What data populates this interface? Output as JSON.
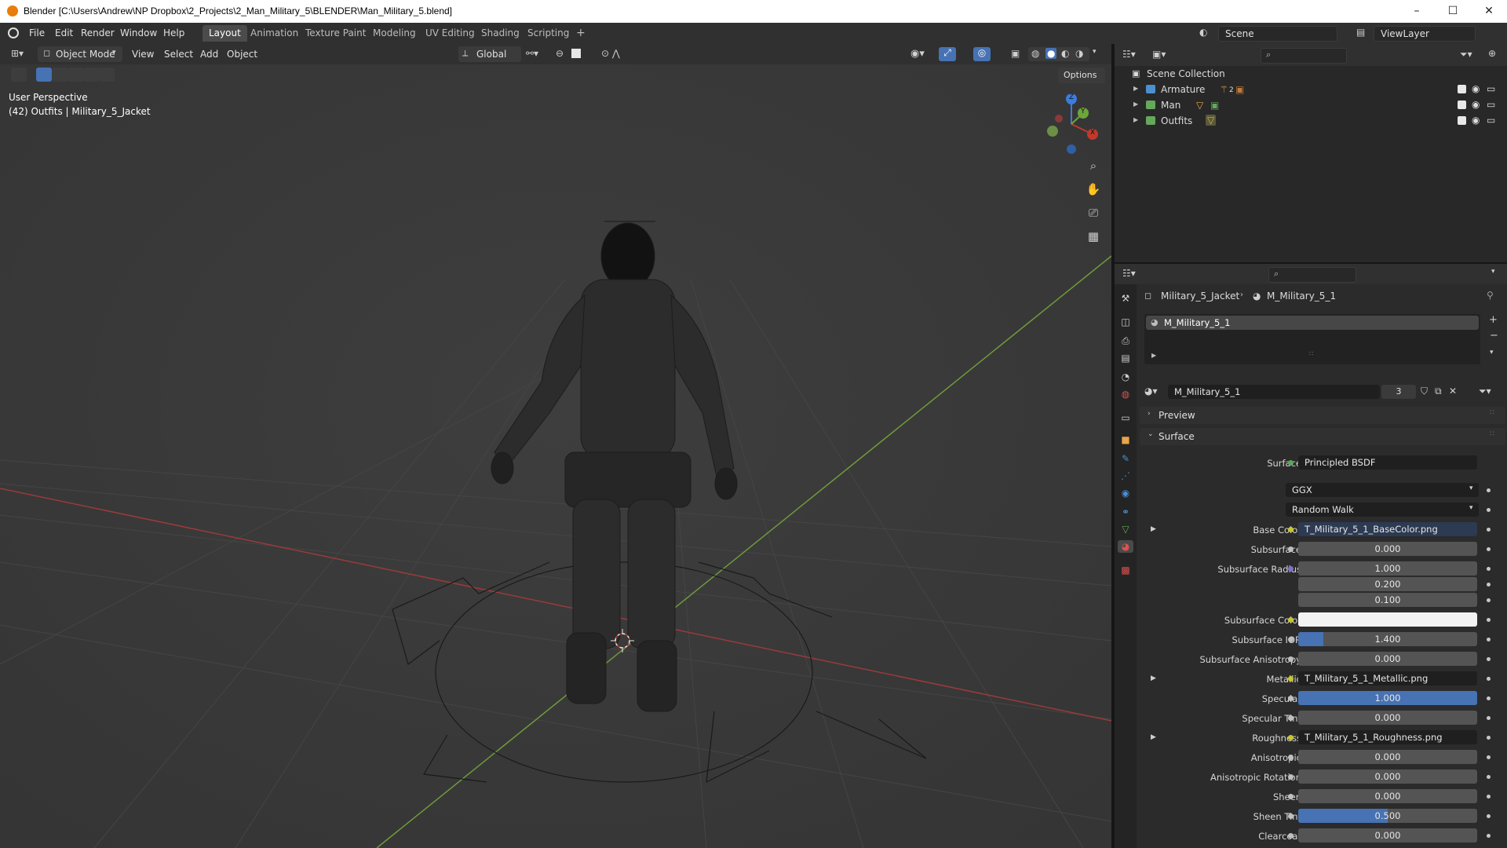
{
  "window": {
    "title": "Blender [C:\\Users\\Andrew\\NP Dropbox\\2_Projects\\2_Man_Military_5\\BLENDER\\Man_Military_5.blend]",
    "minimize": "–",
    "maximize": "☐",
    "close": "✕"
  },
  "menubar": {
    "items": [
      "File",
      "Edit",
      "Render",
      "Window",
      "Help"
    ],
    "workspaces": [
      "Layout",
      "Animation",
      "Texture Paint",
      "Modeling",
      "UV Editing",
      "Shading",
      "Scripting"
    ],
    "active_workspace": "Layout",
    "add_workspace": "+",
    "scene_label": "Scene",
    "viewlayer_label": "ViewLayer"
  },
  "viewport": {
    "mode": "Object Mode",
    "menus": [
      "View",
      "Select",
      "Add",
      "Object"
    ],
    "transform_orientation": "Global",
    "options_label": "Options",
    "perspective_label": "User Perspective",
    "context_label": "(42) Outfits | Military_5_Jacket",
    "gizmo_axes": [
      "X",
      "Y",
      "Z"
    ]
  },
  "outliner": {
    "root": "Scene Collection",
    "items": [
      {
        "label": "Armature",
        "badge": "2"
      },
      {
        "label": "Man",
        "badge": ""
      },
      {
        "label": "Outfits",
        "badge": ""
      }
    ]
  },
  "properties": {
    "breadcrumb_object": "Military_5_Jacket",
    "breadcrumb_material": "M_Military_5_1",
    "slot_name": "M_Military_5_1",
    "material_name": "M_Military_5_1",
    "user_count": "3",
    "panels": {
      "preview": "Preview",
      "surface": "Surface"
    },
    "surface_shader_label": "Surface",
    "surface_shader": "Principled BSDF",
    "distribution": "GGX",
    "subsurface_method": "Random Walk",
    "fields": [
      {
        "label": "Base Color",
        "value": "T_Military_5_1_BaseColor.png",
        "kind": "texture",
        "expand": true
      },
      {
        "label": "Subsurface",
        "value": "0.000",
        "kind": "number",
        "fill": 0
      },
      {
        "label": "Subsurface Radius",
        "value": "1.000",
        "kind": "number",
        "fill": 0,
        "dot": "purple"
      },
      {
        "label": "",
        "value": "0.200",
        "kind": "number",
        "fill": 0
      },
      {
        "label": "",
        "value": "0.100",
        "kind": "number",
        "fill": 0
      },
      {
        "label": "Subsurface Color",
        "value": "",
        "kind": "color",
        "dot": "yellow"
      },
      {
        "label": "Subsurface IOR",
        "value": "1.400",
        "kind": "number",
        "fill": 0.14
      },
      {
        "label": "Subsurface Anisotropy",
        "value": "0.000",
        "kind": "number",
        "fill": 0
      },
      {
        "label": "Metallic",
        "value": "T_Military_5_1_Metallic.png",
        "kind": "texture",
        "expand": true
      },
      {
        "label": "Specular",
        "value": "1.000",
        "kind": "number",
        "fill": 1
      },
      {
        "label": "Specular Tint",
        "value": "0.000",
        "kind": "number",
        "fill": 0
      },
      {
        "label": "Roughness",
        "value": "T_Military_5_1_Roughness.png",
        "kind": "texture",
        "expand": true
      },
      {
        "label": "Anisotropic",
        "value": "0.000",
        "kind": "number",
        "fill": 0
      },
      {
        "label": "Anisotropic Rotation",
        "value": "0.000",
        "kind": "number",
        "fill": 0
      },
      {
        "label": "Sheen",
        "value": "0.000",
        "kind": "number",
        "fill": 0
      },
      {
        "label": "Sheen Tint",
        "value": "0.500",
        "kind": "number",
        "fill": 0.5
      },
      {
        "label": "Clearcoat",
        "value": "0.000",
        "kind": "number",
        "fill": 0
      }
    ]
  },
  "colors": {
    "accent": "#4772b3",
    "x_axis": "#c0392b",
    "y_axis": "#6ca63a",
    "z_axis": "#3b7ddd"
  }
}
